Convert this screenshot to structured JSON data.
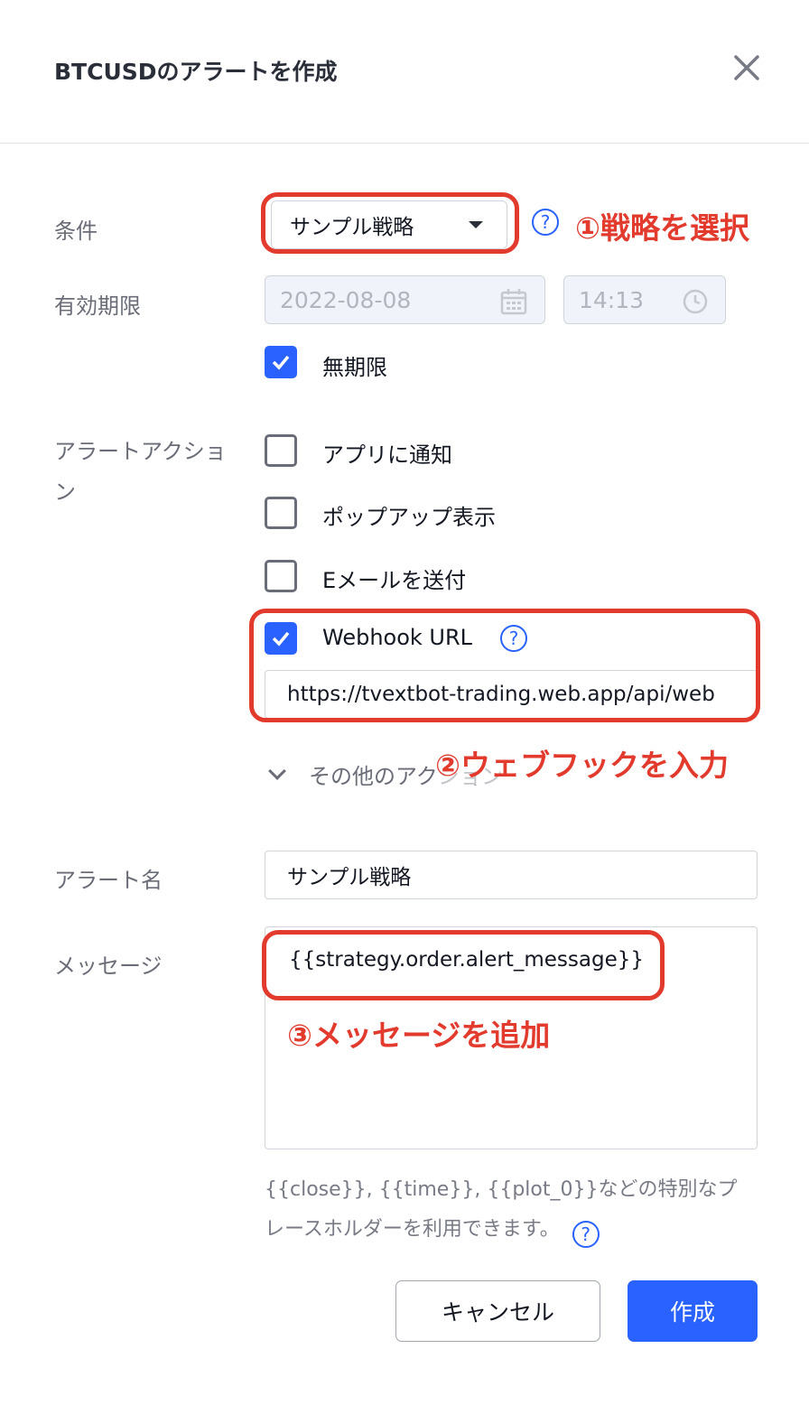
{
  "dialog": {
    "title": "BTCUSDのアラートを作成"
  },
  "condition": {
    "label": "条件",
    "selected": "サンプル戦略"
  },
  "expiration": {
    "label": "有効期限",
    "date": "2022-08-08",
    "time": "14:13",
    "unlimited_label": "無期限",
    "unlimited_checked": true
  },
  "actions": {
    "label": "アラートアクション",
    "items": [
      {
        "label": "アプリに通知",
        "checked": false
      },
      {
        "label": "ポップアップ表示",
        "checked": false
      },
      {
        "label": "Eメールを送付",
        "checked": false
      },
      {
        "label": "Webhook URL",
        "checked": true
      }
    ],
    "webhook_url": "https://tvextbot-trading.web.app/api/web",
    "other_actions": "その他のアクション"
  },
  "alert_name": {
    "label": "アラート名",
    "value": "サンプル戦略"
  },
  "message": {
    "label": "メッセージ",
    "value": "{{strategy.order.alert_message}}",
    "hint": "{{close}}, {{time}}, {{plot_0}}などの特別なプレースホルダーを利用できます。"
  },
  "buttons": {
    "cancel": "キャンセル",
    "create": "作成"
  },
  "annotations": {
    "step1": "①戦略を選択",
    "step2": "②ウェブフックを入力",
    "step3": "③メッセージを追加"
  },
  "colors": {
    "accent": "#2962ff",
    "annotation": "#e23b2e"
  },
  "icons": {
    "help": "?"
  }
}
